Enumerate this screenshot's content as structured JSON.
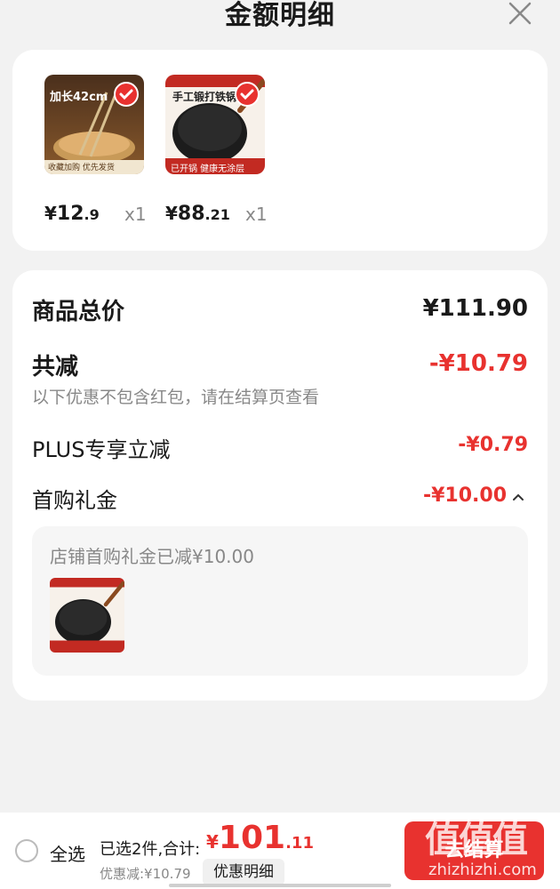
{
  "header": {
    "title": "金额明细"
  },
  "products": [
    {
      "price_symbol": "¥",
      "price_int": "12",
      "price_dec": ".9",
      "qty": "x1",
      "image_caption": "加长42cm",
      "image_footer": "收藏加购 优先发货"
    },
    {
      "price_symbol": "¥",
      "price_int": "88",
      "price_dec": ".21",
      "qty": "x1",
      "image_caption": "手工锻打铁锅",
      "image_footer": "已开锅 健康无涂层"
    }
  ],
  "breakdown": {
    "total_label": "商品总价",
    "total_value": "¥111.90",
    "reduce_label": "共减",
    "reduce_value": "-¥10.79",
    "note": "以下优惠不包含红包，请在结算页查看",
    "plus_label": "PLUS专享立减",
    "plus_value": "-¥0.79",
    "gift_label": "首购礼金",
    "gift_value": "-¥10.00",
    "gift_detail": "店铺首购礼金已减¥10.00"
  },
  "bottom": {
    "select_all": "全选",
    "summary": "已选2件,合计:",
    "total_symbol": "¥",
    "total_int": "101",
    "total_dec": ".11",
    "discount": "优惠减:¥10.79",
    "detail_button": "优惠明细",
    "checkout": "去结算"
  },
  "watermark": {
    "text": "值值值",
    "url": "zhizhizhi.com"
  },
  "colors": {
    "accent": "#e8322f",
    "muted": "#888888"
  }
}
